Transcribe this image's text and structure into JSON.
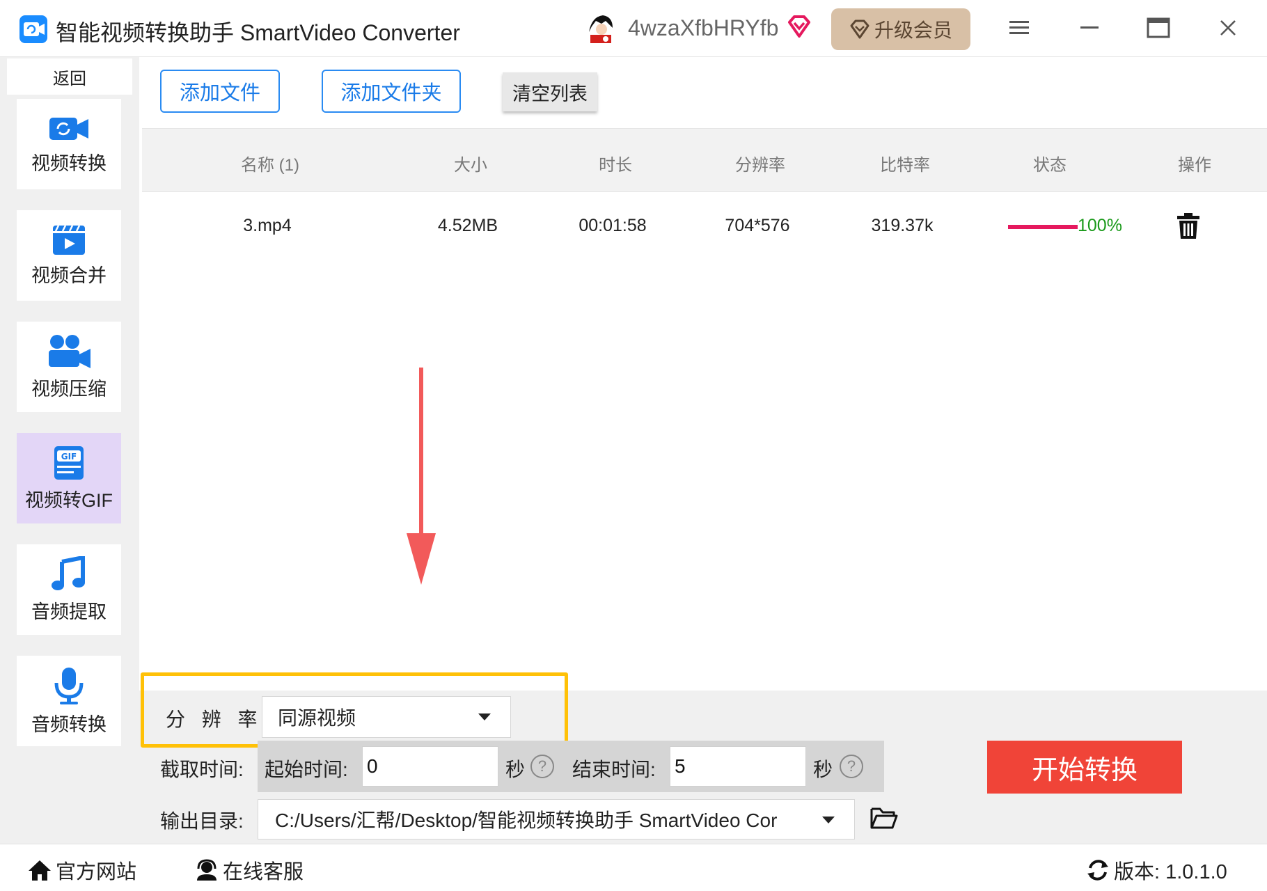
{
  "app": {
    "title": "智能视频转换助手 SmartVideo Converter",
    "username": "4wzaXfbHRYfb",
    "upgrade_label": "升级会员"
  },
  "sidebar": {
    "back_label": "返回",
    "items": [
      {
        "label": "视频转换",
        "icon": "video-convert-icon"
      },
      {
        "label": "视频合并",
        "icon": "video-merge-icon"
      },
      {
        "label": "视频压缩",
        "icon": "video-compress-icon"
      },
      {
        "label": "视频转GIF",
        "icon": "gif-icon",
        "active": true
      },
      {
        "label": "音频提取",
        "icon": "music-note-icon"
      },
      {
        "label": "音频转换",
        "icon": "microphone-icon"
      }
    ]
  },
  "toolbar": {
    "add_file": "添加文件",
    "add_folder": "添加文件夹",
    "clear_list": "清空列表"
  },
  "table": {
    "headers": [
      "名称 (1)",
      "大小",
      "时长",
      "分辨率",
      "比特率",
      "状态",
      "操作"
    ],
    "rows": [
      {
        "name": "3.mp4",
        "size": "4.52MB",
        "duration": "00:01:58",
        "resolution": "704*576",
        "bitrate": "319.37k",
        "progress": 100,
        "progress_text": "100%"
      }
    ]
  },
  "settings": {
    "resolution_label": "分 辨 率 ：",
    "resolution_value": "同源视频",
    "clip_label": "截取时间:",
    "start_label": "起始时间:",
    "start_value": "0",
    "end_label": "结束时间:",
    "end_value": "5",
    "sec_label": "秒",
    "help_glyph": "?",
    "output_label": "输出目录:",
    "output_value": "C:/Users/汇帮/Desktop/智能视频转换助手 SmartVideo Cor"
  },
  "actions": {
    "start_label": "开始转换"
  },
  "footer": {
    "website": "官方网站",
    "support": "在线客服",
    "version": "版本:  1.0.1.0"
  },
  "colors": {
    "accent": "#2a8bf2",
    "start_button": "#f04438",
    "highlight": "#ffc107",
    "progress": "#e5195e",
    "progress_text": "#1a9a1a",
    "upgrade": "#d8c0a6",
    "arrow": "#f25a5a"
  }
}
